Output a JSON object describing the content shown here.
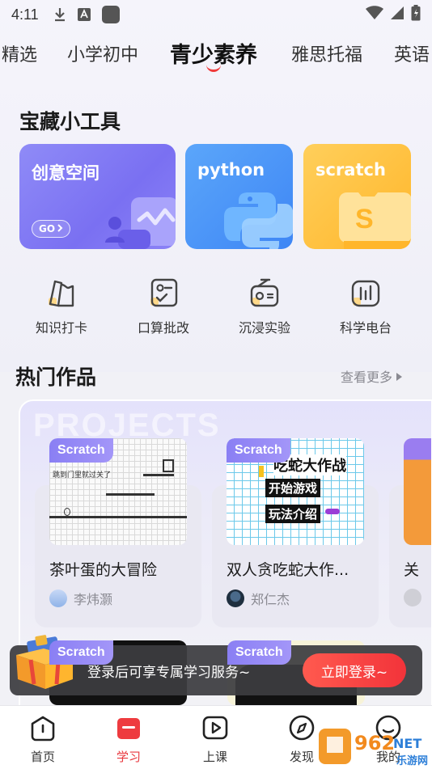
{
  "status_bar": {
    "time": "4:11"
  },
  "top_tabs": [
    "精选",
    "小学初中",
    "青少素养",
    "雅思托福",
    "英语"
  ],
  "active_tab": "青少素养",
  "tools_section": {
    "title": "宝藏小工具"
  },
  "tool_cards": [
    {
      "label": "创意空间",
      "go_label": "GO",
      "color": "#7f77f4"
    },
    {
      "label": "python",
      "color": "#4a91f7"
    },
    {
      "label": "scratch",
      "color": "#ffbf3a"
    }
  ],
  "shortcuts": [
    {
      "label": "知识打卡",
      "icon": "card-icon"
    },
    {
      "label": "口算批改",
      "icon": "check-board-icon"
    },
    {
      "label": "沉浸实验",
      "icon": "radio-lab-icon"
    },
    {
      "label": "科学电台",
      "icon": "chart-radio-icon"
    }
  ],
  "hot_section": {
    "title": "热门作品",
    "more_label": "查看更多"
  },
  "watermark": "PROJECTS",
  "projects": [
    {
      "badge": "Scratch",
      "title": "茶叶蛋的大冒险",
      "author": "李炜灏",
      "thumb_text": "跳到门里就过关了"
    },
    {
      "badge": "Scratch",
      "title": "双人贪吃蛇大作...",
      "author": "郑仁杰",
      "thumb_heading": "吃蛇大作战",
      "thumb_btn1": "开始游戏",
      "thumb_btn2": "玩法介绍"
    },
    {
      "title": "关"
    }
  ],
  "projects_row2": [
    {
      "badge": "Scratch"
    },
    {
      "badge": "Scratch"
    }
  ],
  "login_banner": {
    "text": "登录后可享专属学习服务~",
    "button": "立即登录~"
  },
  "bottom_nav": [
    {
      "label": "首页",
      "icon": "home-icon"
    },
    {
      "label": "学习",
      "icon": "study-icon",
      "active": true
    },
    {
      "label": "上课",
      "icon": "play-class-icon"
    },
    {
      "label": "发现",
      "icon": "compass-icon"
    },
    {
      "label": "我的",
      "icon": "profile-icon"
    }
  ],
  "site_watermark": {
    "brand": "962",
    "domain": "NET",
    "sub": "乐游网"
  },
  "colors": {
    "accent_red": "#f03a3a",
    "purple": "#7f77f4",
    "blue": "#4a91f7",
    "yellow": "#ffbf3a"
  }
}
